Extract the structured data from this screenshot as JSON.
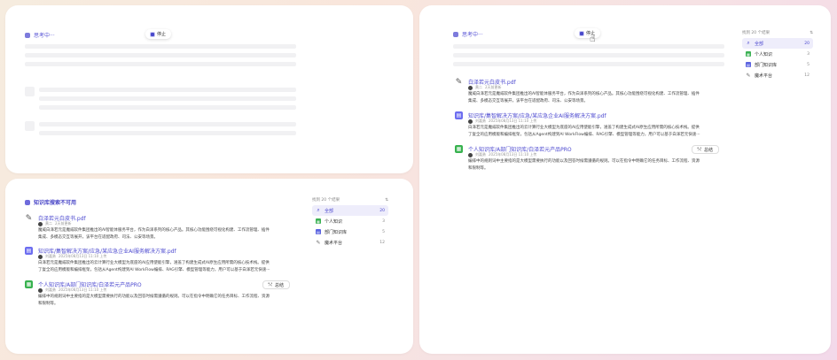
{
  "thinking_label": "思考中···",
  "stop_label": "停止",
  "status_label": "知识库搜索不可用",
  "summary_label": "总结",
  "filters": {
    "header": "找到 20 个结果",
    "items": [
      {
        "label": "全部",
        "count": "20",
        "icon": "search-icon"
      },
      {
        "label": "个人知识",
        "count": "3",
        "icon": "sheet-icon"
      },
      {
        "label": "部门知识库",
        "count": "5",
        "icon": "kb-icon"
      },
      {
        "label": "魔术平台",
        "count": "12",
        "icon": "platform-icon"
      }
    ]
  },
  "results": [
    {
      "title": "白泽若元白皮书.pdf",
      "author": "黄二",
      "time": "2天前更新",
      "body_line1": "魔威白泽若元是魔威软件集团推出的AI智能体服务平台，作为白泽系列的核心产品。其核心功能围绕可视化构建、工作流管理、插件",
      "body_line2": "集成、多模态交互等展开，该平台在适配政府、司法、公安等场景。",
      "icon": "document-icon"
    },
    {
      "title": "知识库/集智解决方案/应急/某应急企业AI服务解决方案.pdf",
      "author": "刘嘉勇",
      "time": "2025年08月13日 11:10 上传",
      "body_line1": "白泽若元是魔威软件集团推出的云计算行业大模型为底座的AI应用使能引擎，涵盖了构建生成式AI原生应用所需的核心技术栈。提供",
      "body_line2": "了复全的应用模版和编排框架，包括从Agent构建到AI WorkFlow编排、RAG引擎、模型管理等能力，用户可以基于白泽若元快速···",
      "icon": "knowledge-base-icon"
    },
    {
      "title": "个人知识库/A部门知识库/白泽若元产品PRO",
      "author": "刘嘉勇",
      "time": "2025年08月13日 11:10 上传",
      "body_line1": "编排中的规则词中主要指的是大模型需要执行的功能以及回答时候需遵循的规则。可以在指令中明确它的任务目标、工作流程、资源",
      "body_line2": "和限制等。",
      "icon": "sheet-icon"
    }
  ]
}
